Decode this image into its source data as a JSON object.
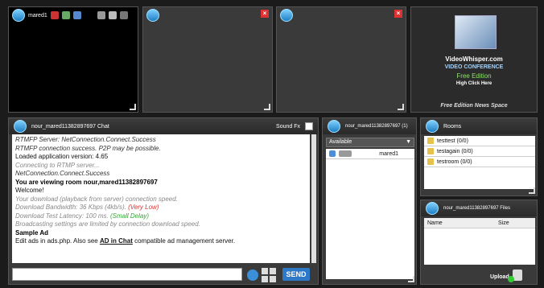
{
  "videos": [
    {
      "label": "mared1"
    },
    {
      "label": ""
    },
    {
      "label": ""
    }
  ],
  "promo": {
    "line1": "VideoWhisper.com",
    "line2": "Video Conference",
    "line3": "Free Edition",
    "line4": "High Click Here",
    "footer": "Free Edition News Space"
  },
  "chat": {
    "title": "nour_mared11382897697 Chat",
    "soundfx_label": "Sound Fx",
    "lines": [
      "RTMFP Server: NetConnection.Connect.Success",
      "RTMFP connection success. P2P may be possible.",
      "Loaded application version: 4.65",
      "Connecting to RTMP server...",
      "NetConnection.Connect.Success",
      "You are viewing room nour,mared11382897697",
      "Welcome!",
      "Your download (playback from server) connection speed.",
      "Download Bandwidth: 36 Kbps (4kb/s).",
      "(Very Low)",
      "Download Test Latency: 100 ms.",
      "(Small Delay)",
      "Broadcasting settings are limited by connection download speed.",
      "Sample Ad",
      "Edit ads in ads.php. Also see",
      "AD in Chat",
      "compatible ad management server."
    ],
    "input_value": "",
    "send_label": "SEND"
  },
  "users": {
    "title": "nour_mared11382897697 (1)",
    "status_selected": "Available",
    "items": [
      {
        "name": "mared1"
      }
    ]
  },
  "rooms": {
    "title": "Rooms",
    "items": [
      {
        "name": "testtest (0/0)"
      },
      {
        "name": "testagain (0/0)"
      },
      {
        "name": "testroom (0/0)"
      }
    ]
  },
  "files": {
    "title": "nour_mared11382897697 Files",
    "col_name": "Name",
    "col_size": "Size",
    "upload_label": "Upload"
  },
  "colors": {
    "accent": "#2e78c8",
    "panel": "#3a3a3a",
    "close": "#dd3333"
  }
}
